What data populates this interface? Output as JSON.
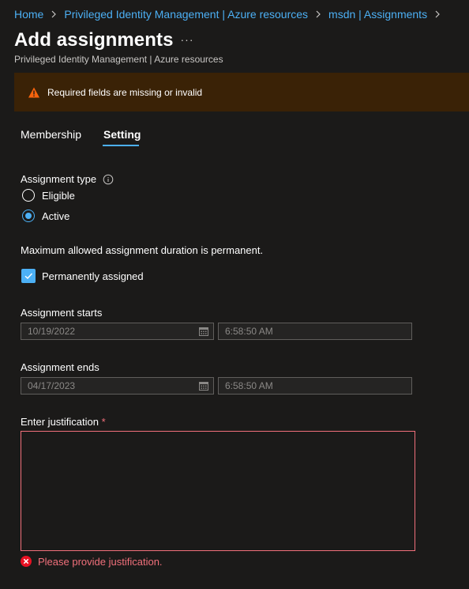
{
  "breadcrumb": {
    "items": [
      "Home",
      "Privileged Identity Management | Azure resources",
      "msdn | Assignments"
    ]
  },
  "header": {
    "title": "Add assignments",
    "more_label": "···",
    "subtitle": "Privileged Identity Management | Azure resources"
  },
  "banner": {
    "message": "Required fields are missing or invalid",
    "icon": "warning-icon",
    "background": "#3a2206",
    "icon_color": "#f7630c"
  },
  "tabs": [
    {
      "label": "Membership",
      "selected": false
    },
    {
      "label": "Setting",
      "selected": true
    }
  ],
  "assignment_type": {
    "label": "Assignment type",
    "options": [
      {
        "label": "Eligible",
        "selected": false
      },
      {
        "label": "Active",
        "selected": true
      }
    ]
  },
  "duration_note": "Maximum allowed assignment duration is permanent.",
  "permanent": {
    "label": "Permanently assigned",
    "checked": true
  },
  "starts": {
    "label": "Assignment starts",
    "date": "10/19/2022",
    "time": "6:58:50 AM"
  },
  "ends": {
    "label": "Assignment ends",
    "date": "04/17/2023",
    "time": "6:58:50 AM"
  },
  "justification": {
    "label": "Enter justification",
    "required_marker": "*",
    "value": "",
    "error": "Please provide justification."
  },
  "colors": {
    "accent": "#4cb0f5",
    "error": "#f1707b",
    "background": "#1b1a19"
  }
}
